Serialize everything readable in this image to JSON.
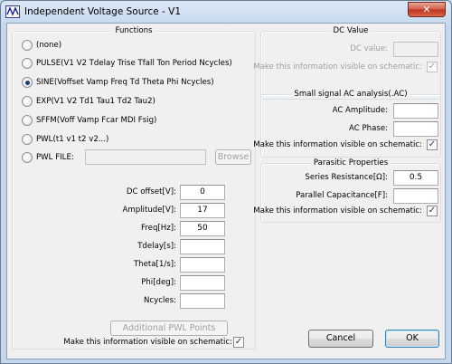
{
  "window": {
    "title": "Independent Voltage Source - V1",
    "close_glyph": "✕"
  },
  "functions": {
    "title": "Functions",
    "options": [
      {
        "label": "(none)",
        "checked": false
      },
      {
        "label": "PULSE(V1 V2 Tdelay Trise Tfall Ton Period Ncycles)",
        "checked": false
      },
      {
        "label": "SINE(Voffset Vamp Freq Td Theta Phi Ncycles)",
        "checked": true
      },
      {
        "label": "EXP(V1 V2 Td1 Tau1 Td2 Tau2)",
        "checked": false
      },
      {
        "label": "SFFM(Voff Vamp Fcar MDI Fsig)",
        "checked": false
      },
      {
        "label": "PWL(t1 v1 t2 v2...)",
        "checked": false
      },
      {
        "label": "PWL FILE:",
        "checked": false
      }
    ],
    "pwl_file_value": "",
    "browse_label": "Browse",
    "params": [
      {
        "label": "DC offset[V]:",
        "value": "0"
      },
      {
        "label": "Amplitude[V]:",
        "value": "17"
      },
      {
        "label": "Freq[Hz]:",
        "value": "50"
      },
      {
        "label": "Tdelay[s]:",
        "value": ""
      },
      {
        "label": "Theta[1/s]:",
        "value": ""
      },
      {
        "label": "Phi[deg]:",
        "value": ""
      },
      {
        "label": "Ncycles:",
        "value": ""
      }
    ],
    "additional_pwl_label": "Additional PWL Points",
    "visible_label": "Make this information visible on schematic:",
    "check_glyph": "✓"
  },
  "dc_value": {
    "title": "DC Value",
    "label": "DC value:",
    "value": "",
    "visible_label": "Make this information visible on schematic:",
    "check_glyph": "✓"
  },
  "ac": {
    "title": "Small signal AC analysis(.AC)",
    "amplitude_label": "AC Amplitude:",
    "amplitude_value": "",
    "phase_label": "AC Phase:",
    "phase_value": "",
    "visible_label": "Make this information visible on schematic:",
    "check_glyph": "✓"
  },
  "parasitic": {
    "title": "Parasitic Properties",
    "resistance_label": "Series Resistance[Ω]:",
    "resistance_value": "0.5",
    "capacitance_label": "Parallel Capacitance[F]:",
    "capacitance_value": "",
    "visible_label": "Make this information visible on schematic:",
    "check_glyph": "✓"
  },
  "buttons": {
    "cancel": "Cancel",
    "ok": "OK"
  },
  "colors": {
    "titlebar": "#c4d7ec",
    "close": "#c0321c",
    "client": "#f0f0f0"
  }
}
